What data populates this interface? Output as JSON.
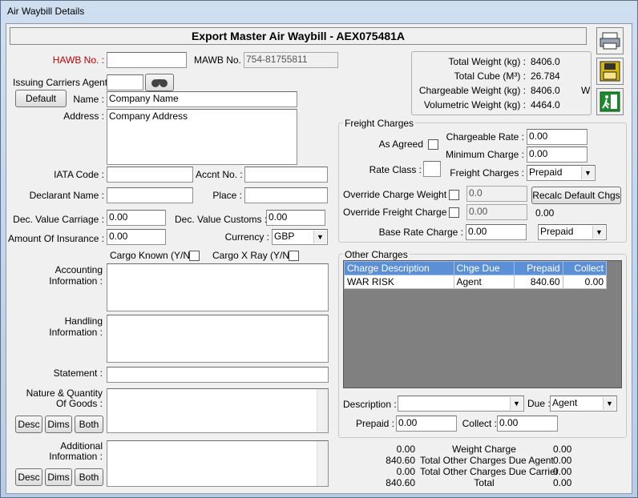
{
  "window": {
    "title": "Air Waybill Details"
  },
  "header": {
    "title": "Export Master Air Waybill - AEX075481A"
  },
  "left": {
    "hawb_label": "HAWB No. :",
    "hawb_value": "",
    "mawb_label": "MAWB No. :",
    "mawb_value": "754-81755811",
    "issuing_label": "Issuing Carriers Agent :",
    "issuing_value": "",
    "default_btn": "Default",
    "name_label": "Name :",
    "name_value": "Company Name",
    "address_label": "Address :",
    "address_value": "Company Address",
    "iata_label": "IATA Code :",
    "accnt_label": "Accnt No. :",
    "declarant_label": "Declarant Name :",
    "place_label": "Place :",
    "dec_carriage_label": "Dec. Value Carriage :",
    "dec_carriage_value": "0.00",
    "dec_customs_label": "Dec. Value Customs :",
    "dec_customs_value": "0.00",
    "insurance_label": "Amount Of Insurance :",
    "insurance_value": "0.00",
    "currency_label": "Currency :",
    "currency_value": "GBP",
    "cargo_known_label": "Cargo Known (Y/N)",
    "cargo_xray_label": "Cargo X Ray (Y/N)",
    "accounting_label_1": "Accounting",
    "accounting_label_2": "Information :",
    "handling_label_1": "Handling",
    "handling_label_2": "Information :",
    "statement_label": "Statement :",
    "nature_label_1": "Nature & Quantity",
    "nature_label_2": "Of Goods :",
    "additional_label_1": "Additional",
    "additional_label_2": "Information :",
    "desc_btn": "Desc",
    "dims_btn": "Dims",
    "both_btn": "Both"
  },
  "totals_box": {
    "rows": [
      {
        "label": "Total Weight (kg) :",
        "value": "8406.0",
        "suffix": ""
      },
      {
        "label": "Total Cube (M³) :",
        "value": "26.784",
        "suffix": ""
      },
      {
        "label": "Chargeable Weight (kg) :",
        "value": "8406.0",
        "suffix": "W"
      },
      {
        "label": "Volumetric Weight (kg) :",
        "value": "4464.0",
        "suffix": ""
      }
    ]
  },
  "freight": {
    "title": "Freight Charges",
    "as_agreed_label": "As Agreed",
    "chargeable_rate_label": "Chargeable Rate :",
    "chargeable_rate_value": "0.00",
    "minimum_charge_label": "Minimum Charge :",
    "minimum_charge_value": "0.00",
    "rate_class_label": "Rate Class :",
    "freight_charges_label": "Freight Charges :",
    "freight_charges_value": "Prepaid",
    "override_weight_label": "Override Charge Weight",
    "override_weight_value": "0.0",
    "recalc_btn": "Recalc Default Chgs",
    "override_freight_label": "Override Freight Charge",
    "override_freight_value": "0.00",
    "override_freight_display": "0.00",
    "base_rate_label": "Base Rate Charge :",
    "base_rate_value": "0.00",
    "base_rate_mode": "Prepaid"
  },
  "other": {
    "title": "Other Charges",
    "columns": [
      "Charge Description",
      "Chge Due",
      "Prepaid",
      "Collect"
    ],
    "rows": [
      {
        "desc": "WAR RISK",
        "due": "Agent",
        "prepaid": "840.60",
        "collect": "0.00"
      }
    ],
    "description_label": "Description :",
    "description_value": "",
    "due_label": "Due :",
    "due_value": "Agent",
    "prepaid_label": "Prepaid :",
    "prepaid_value": "0.00",
    "collect_label": "Collect :",
    "collect_value": "0.00"
  },
  "summary": {
    "rows": [
      {
        "left": "0.00",
        "label": "Weight Charge",
        "right": "0.00"
      },
      {
        "left": "840.60",
        "label": "Total Other Charges Due Agent",
        "right": "0.00"
      },
      {
        "left": "0.00",
        "label": "Total Other Charges Due Carrier",
        "right": "0.00"
      },
      {
        "left": "840.60",
        "label": "Total",
        "right": "0.00"
      }
    ]
  },
  "icons": {
    "print": "printer-icon",
    "save": "save-disk-icon",
    "exit": "exit-door-icon"
  }
}
